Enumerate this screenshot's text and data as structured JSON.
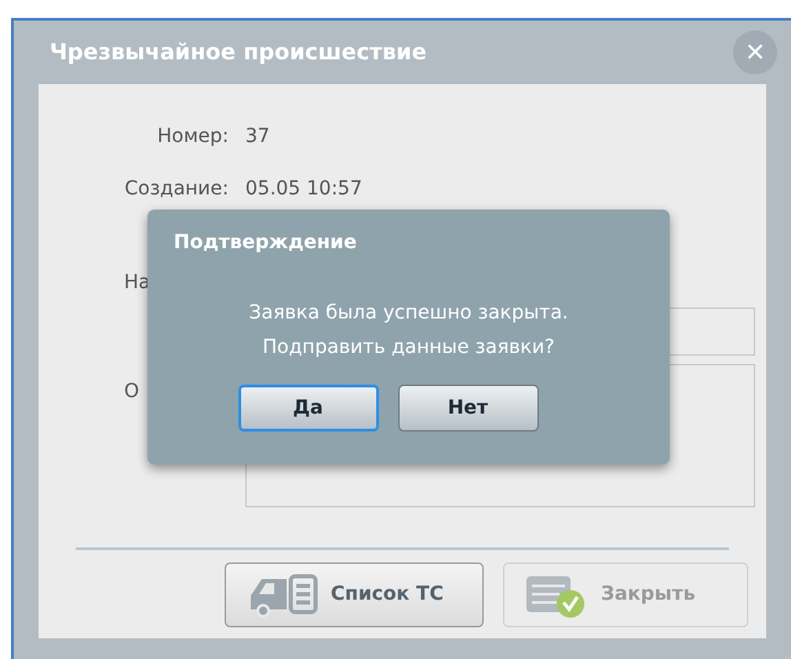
{
  "window": {
    "title": "Чрезвычайное происшествие",
    "close_glyph": "✕"
  },
  "fields": [
    {
      "kind": "text",
      "label": "Номер:",
      "value": "37"
    },
    {
      "kind": "text",
      "label": "Создание:",
      "value": "05.05 10:57"
    },
    {
      "kind": "text",
      "label": "На",
      "label_cut": true
    },
    {
      "kind": "input"
    },
    {
      "kind": "textarea",
      "label": "О",
      "label_cut": true
    }
  ],
  "buttons": [
    {
      "label": "Список ТС",
      "kind": "vehicles",
      "disabled": false
    },
    {
      "label": "Закрыть",
      "kind": "close",
      "disabled": true
    }
  ],
  "dialog": {
    "title": "Подтверждение",
    "message": [
      "Заявка была успешно закрыта.",
      "Подправить данные заявки?"
    ],
    "buttons": [
      {
        "label": "Да",
        "focused": true
      },
      {
        "label": "Нет",
        "focused": false
      }
    ]
  }
}
